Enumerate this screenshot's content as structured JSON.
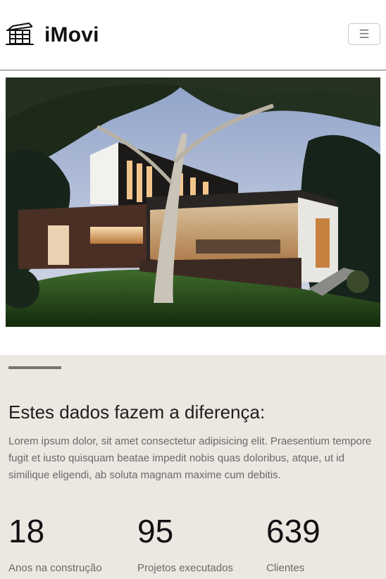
{
  "brand": {
    "name": "iMovi",
    "logo_icon": "house-icon"
  },
  "nav": {
    "toggle_icon": "hamburger-menu-icon",
    "toggle_glyph": "☰"
  },
  "hero": {
    "image": "modern-house-photo"
  },
  "stats": {
    "heading": "Estes dados fazem a diferença:",
    "description": "Lorem ipsum dolor, sit amet consectetur adipisicing elit. Praesentium tempore fugit et iusto quisquam beatae impedit nobis quas doloribus, atque, ut id similique eligendi, ab soluta magnam maxime cum debitis.",
    "items": [
      {
        "value": "18",
        "label": "Anos na construção"
      },
      {
        "value": "95",
        "label": "Projetos executados"
      },
      {
        "value": "639",
        "label": "Clientes"
      }
    ]
  },
  "colors": {
    "stats_background": "#ebe7e1",
    "rule": "#777472",
    "text_muted": "#6a6a6a"
  }
}
